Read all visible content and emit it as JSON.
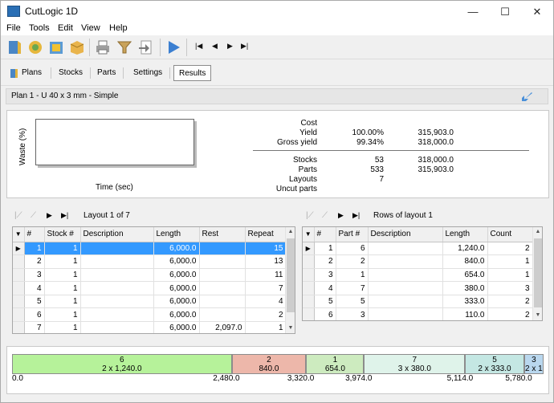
{
  "window": {
    "title": "CutLogic 1D",
    "min_label": "—",
    "max_label": "☐",
    "close_label": "✕"
  },
  "menu": [
    "File",
    "Tools",
    "Edit",
    "View",
    "Help"
  ],
  "toolbar": {
    "buttons": [
      "open-icon",
      "parts-icon",
      "stock-icon",
      "package-icon",
      "print-icon",
      "filter-icon",
      "export-icon",
      "play-icon"
    ],
    "nav": [
      "|◀",
      "◀",
      "▶",
      "▶|"
    ]
  },
  "tabs": [
    {
      "label": "Plans",
      "active": false
    },
    {
      "label": "Stocks",
      "active": false
    },
    {
      "label": "Parts",
      "active": false
    },
    {
      "label": "Settings",
      "active": false
    },
    {
      "label": "Results",
      "active": true
    }
  ],
  "plan": {
    "title": "Plan 1  -  U 40 x 3 mm  -  Simple"
  },
  "summary": {
    "chart_ylabel": "Waste (%)",
    "chart_xlabel": "Time (sec)",
    "rows_top": [
      {
        "label": "Cost",
        "pct": "",
        "val": ""
      },
      {
        "label": "Yield",
        "pct": "100.00%",
        "val": "315,903.0"
      },
      {
        "label": "Gross yield",
        "pct": "99.34%",
        "val": "318,000.0"
      }
    ],
    "rows_bottom": [
      {
        "label": "Stocks",
        "pct": "53",
        "val": "318,000.0"
      },
      {
        "label": "Parts",
        "pct": "533",
        "val": "315,903.0"
      },
      {
        "label": "Layouts",
        "pct": "7",
        "val": ""
      },
      {
        "label": "Uncut parts",
        "pct": "",
        "val": ""
      }
    ]
  },
  "layouts": {
    "nav_label": "Layout 1 of 7",
    "columns": [
      "#",
      "Stock #",
      "Description",
      "Length",
      "Rest",
      "Repeat"
    ],
    "rows": [
      [
        "1",
        "1",
        "",
        "6,000.0",
        "",
        "15"
      ],
      [
        "2",
        "1",
        "",
        "6,000.0",
        "",
        "13"
      ],
      [
        "3",
        "1",
        "",
        "6,000.0",
        "",
        "11"
      ],
      [
        "4",
        "1",
        "",
        "6,000.0",
        "",
        "7"
      ],
      [
        "5",
        "1",
        "",
        "6,000.0",
        "",
        "4"
      ],
      [
        "6",
        "1",
        "",
        "6,000.0",
        "",
        "2"
      ],
      [
        "7",
        "1",
        "",
        "6,000.0",
        "2,097.0",
        "1"
      ]
    ]
  },
  "rows_of_layout": {
    "nav_label": "Rows of layout 1",
    "columns": [
      "#",
      "Part #",
      "Description",
      "Length",
      "Count"
    ],
    "rows": [
      [
        "1",
        "6",
        "",
        "1,240.0",
        "2"
      ],
      [
        "2",
        "2",
        "",
        "840.0",
        "1"
      ],
      [
        "3",
        "1",
        "",
        "654.0",
        "1"
      ],
      [
        "4",
        "7",
        "",
        "380.0",
        "3"
      ],
      [
        "5",
        "5",
        "",
        "333.0",
        "2"
      ],
      [
        "6",
        "3",
        "",
        "110.0",
        "2"
      ]
    ]
  },
  "cut_bar": {
    "total": 6000,
    "segments": [
      {
        "title": "6",
        "detail": "2 x 1,240.0",
        "start": 0,
        "end": 2480,
        "color": "#b6f29a"
      },
      {
        "title": "2",
        "detail": "840.0",
        "start": 2480,
        "end": 3320,
        "color": "#edb7aa"
      },
      {
        "title": "1",
        "detail": "654.0",
        "start": 3320,
        "end": 3974,
        "color": "#cdebbf"
      },
      {
        "title": "7",
        "detail": "3 x 380.0",
        "start": 3974,
        "end": 5114,
        "color": "#dff3ea"
      },
      {
        "title": "5",
        "detail": "2 x 333.0",
        "start": 5114,
        "end": 5780,
        "color": "#c4e7e3"
      },
      {
        "title": "3",
        "detail": "2 x 1",
        "start": 5780,
        "end": 6000,
        "color": "#b9d7ee"
      }
    ],
    "ticks": [
      {
        "label": "0.0",
        "at": 0
      },
      {
        "label": "2,480.0",
        "at": 2480
      },
      {
        "label": "3,320.0",
        "at": 3320
      },
      {
        "label": "3,974.0",
        "at": 3974
      },
      {
        "label": "5,114.0",
        "at": 5114
      },
      {
        "label": "5,780.0",
        "at": 5780
      }
    ]
  }
}
